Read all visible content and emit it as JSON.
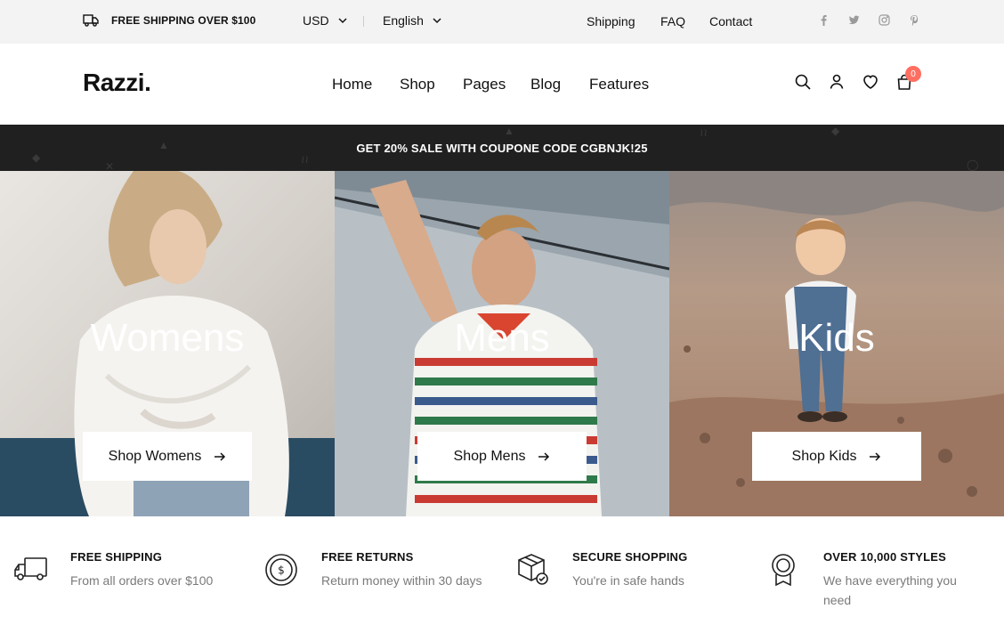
{
  "topbar": {
    "shipping_text": "FREE SHIPPING OVER $100",
    "currency": "USD",
    "language": "English",
    "links": [
      "Shipping",
      "FAQ",
      "Contact"
    ],
    "social_icons": [
      "facebook-icon",
      "twitter-icon",
      "instagram-icon",
      "pinterest-icon"
    ]
  },
  "header": {
    "logo": "Razzi.",
    "nav": [
      "Home",
      "Shop",
      "Pages",
      "Blog",
      "Features"
    ],
    "icons": [
      "search-icon",
      "user-icon",
      "heart-icon",
      "bag-icon"
    ],
    "cart_count": "0"
  },
  "promo": {
    "text": "GET 20% SALE WITH COUPONE CODE CGBNJK!25"
  },
  "categories": [
    {
      "title": "Womens",
      "button": "Shop Womens"
    },
    {
      "title": "Mens",
      "button": "Shop Mens"
    },
    {
      "title": "Kids",
      "button": "Shop Kids"
    }
  ],
  "features": [
    {
      "icon": "truck-icon",
      "title": "FREE SHIPPING",
      "desc": "From all orders over $100"
    },
    {
      "icon": "dollar-coin-icon",
      "title": "FREE RETURNS",
      "desc": "Return money within 30 days"
    },
    {
      "icon": "package-check-icon",
      "title": "SECURE SHOPPING",
      "desc": "You're in safe hands"
    },
    {
      "icon": "award-badge-icon",
      "title": "OVER 10,000 STYLES",
      "desc_line1": "We have everything you",
      "desc_line2": "need"
    }
  ],
  "colors": {
    "badge": "#ff6f61",
    "promo_bg": "#202020",
    "topbar_bg": "#f3f3f3"
  }
}
